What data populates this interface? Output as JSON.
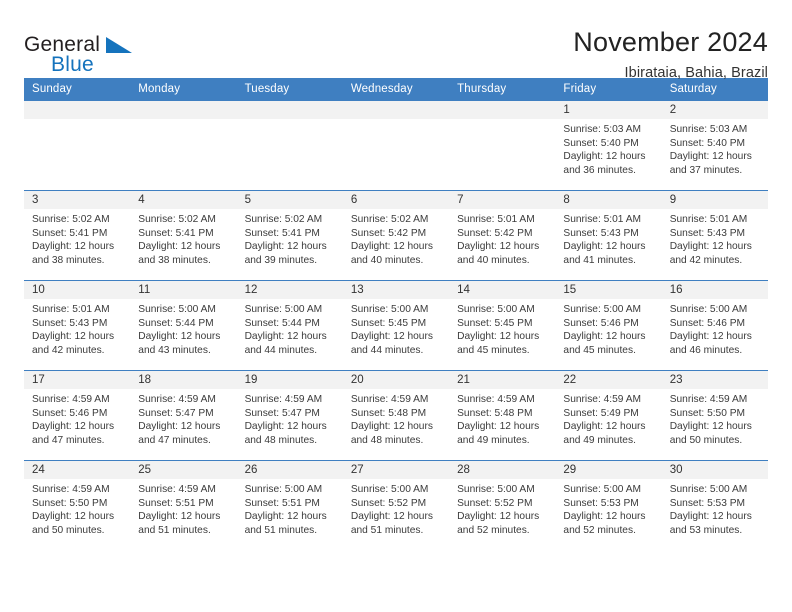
{
  "logo": {
    "word_primary": "General",
    "word_secondary": "Blue",
    "triangle_color": "#1573bd"
  },
  "header": {
    "title": "November 2024",
    "subtitle": "Ibirataia, Bahia, Brazil"
  },
  "colors": {
    "header_blue": "#3f7fc1",
    "day_band_gray": "#f2f2f2",
    "logo_blue": "#1573bd",
    "text": "#333333"
  },
  "calendar": {
    "weekdays": [
      "Sunday",
      "Monday",
      "Tuesday",
      "Wednesday",
      "Thursday",
      "Friday",
      "Saturday"
    ],
    "weeks": [
      [
        {
          "day": "",
          "sunrise": "",
          "sunset": "",
          "daylight_line1": "",
          "daylight_line2": "",
          "empty": true
        },
        {
          "day": "",
          "sunrise": "",
          "sunset": "",
          "daylight_line1": "",
          "daylight_line2": "",
          "empty": true
        },
        {
          "day": "",
          "sunrise": "",
          "sunset": "",
          "daylight_line1": "",
          "daylight_line2": "",
          "empty": true
        },
        {
          "day": "",
          "sunrise": "",
          "sunset": "",
          "daylight_line1": "",
          "daylight_line2": "",
          "empty": true
        },
        {
          "day": "",
          "sunrise": "",
          "sunset": "",
          "daylight_line1": "",
          "daylight_line2": "",
          "empty": true
        },
        {
          "day": "1",
          "sunrise": "Sunrise: 5:03 AM",
          "sunset": "Sunset: 5:40 PM",
          "daylight_line1": "Daylight: 12 hours",
          "daylight_line2": "and 36 minutes.",
          "empty": false
        },
        {
          "day": "2",
          "sunrise": "Sunrise: 5:03 AM",
          "sunset": "Sunset: 5:40 PM",
          "daylight_line1": "Daylight: 12 hours",
          "daylight_line2": "and 37 minutes.",
          "empty": false
        }
      ],
      [
        {
          "day": "3",
          "sunrise": "Sunrise: 5:02 AM",
          "sunset": "Sunset: 5:41 PM",
          "daylight_line1": "Daylight: 12 hours",
          "daylight_line2": "and 38 minutes.",
          "empty": false
        },
        {
          "day": "4",
          "sunrise": "Sunrise: 5:02 AM",
          "sunset": "Sunset: 5:41 PM",
          "daylight_line1": "Daylight: 12 hours",
          "daylight_line2": "and 38 minutes.",
          "empty": false
        },
        {
          "day": "5",
          "sunrise": "Sunrise: 5:02 AM",
          "sunset": "Sunset: 5:41 PM",
          "daylight_line1": "Daylight: 12 hours",
          "daylight_line2": "and 39 minutes.",
          "empty": false
        },
        {
          "day": "6",
          "sunrise": "Sunrise: 5:02 AM",
          "sunset": "Sunset: 5:42 PM",
          "daylight_line1": "Daylight: 12 hours",
          "daylight_line2": "and 40 minutes.",
          "empty": false
        },
        {
          "day": "7",
          "sunrise": "Sunrise: 5:01 AM",
          "sunset": "Sunset: 5:42 PM",
          "daylight_line1": "Daylight: 12 hours",
          "daylight_line2": "and 40 minutes.",
          "empty": false
        },
        {
          "day": "8",
          "sunrise": "Sunrise: 5:01 AM",
          "sunset": "Sunset: 5:43 PM",
          "daylight_line1": "Daylight: 12 hours",
          "daylight_line2": "and 41 minutes.",
          "empty": false
        },
        {
          "day": "9",
          "sunrise": "Sunrise: 5:01 AM",
          "sunset": "Sunset: 5:43 PM",
          "daylight_line1": "Daylight: 12 hours",
          "daylight_line2": "and 42 minutes.",
          "empty": false
        }
      ],
      [
        {
          "day": "10",
          "sunrise": "Sunrise: 5:01 AM",
          "sunset": "Sunset: 5:43 PM",
          "daylight_line1": "Daylight: 12 hours",
          "daylight_line2": "and 42 minutes.",
          "empty": false
        },
        {
          "day": "11",
          "sunrise": "Sunrise: 5:00 AM",
          "sunset": "Sunset: 5:44 PM",
          "daylight_line1": "Daylight: 12 hours",
          "daylight_line2": "and 43 minutes.",
          "empty": false
        },
        {
          "day": "12",
          "sunrise": "Sunrise: 5:00 AM",
          "sunset": "Sunset: 5:44 PM",
          "daylight_line1": "Daylight: 12 hours",
          "daylight_line2": "and 44 minutes.",
          "empty": false
        },
        {
          "day": "13",
          "sunrise": "Sunrise: 5:00 AM",
          "sunset": "Sunset: 5:45 PM",
          "daylight_line1": "Daylight: 12 hours",
          "daylight_line2": "and 44 minutes.",
          "empty": false
        },
        {
          "day": "14",
          "sunrise": "Sunrise: 5:00 AM",
          "sunset": "Sunset: 5:45 PM",
          "daylight_line1": "Daylight: 12 hours",
          "daylight_line2": "and 45 minutes.",
          "empty": false
        },
        {
          "day": "15",
          "sunrise": "Sunrise: 5:00 AM",
          "sunset": "Sunset: 5:46 PM",
          "daylight_line1": "Daylight: 12 hours",
          "daylight_line2": "and 45 minutes.",
          "empty": false
        },
        {
          "day": "16",
          "sunrise": "Sunrise: 5:00 AM",
          "sunset": "Sunset: 5:46 PM",
          "daylight_line1": "Daylight: 12 hours",
          "daylight_line2": "and 46 minutes.",
          "empty": false
        }
      ],
      [
        {
          "day": "17",
          "sunrise": "Sunrise: 4:59 AM",
          "sunset": "Sunset: 5:46 PM",
          "daylight_line1": "Daylight: 12 hours",
          "daylight_line2": "and 47 minutes.",
          "empty": false
        },
        {
          "day": "18",
          "sunrise": "Sunrise: 4:59 AM",
          "sunset": "Sunset: 5:47 PM",
          "daylight_line1": "Daylight: 12 hours",
          "daylight_line2": "and 47 minutes.",
          "empty": false
        },
        {
          "day": "19",
          "sunrise": "Sunrise: 4:59 AM",
          "sunset": "Sunset: 5:47 PM",
          "daylight_line1": "Daylight: 12 hours",
          "daylight_line2": "and 48 minutes.",
          "empty": false
        },
        {
          "day": "20",
          "sunrise": "Sunrise: 4:59 AM",
          "sunset": "Sunset: 5:48 PM",
          "daylight_line1": "Daylight: 12 hours",
          "daylight_line2": "and 48 minutes.",
          "empty": false
        },
        {
          "day": "21",
          "sunrise": "Sunrise: 4:59 AM",
          "sunset": "Sunset: 5:48 PM",
          "daylight_line1": "Daylight: 12 hours",
          "daylight_line2": "and 49 minutes.",
          "empty": false
        },
        {
          "day": "22",
          "sunrise": "Sunrise: 4:59 AM",
          "sunset": "Sunset: 5:49 PM",
          "daylight_line1": "Daylight: 12 hours",
          "daylight_line2": "and 49 minutes.",
          "empty": false
        },
        {
          "day": "23",
          "sunrise": "Sunrise: 4:59 AM",
          "sunset": "Sunset: 5:50 PM",
          "daylight_line1": "Daylight: 12 hours",
          "daylight_line2": "and 50 minutes.",
          "empty": false
        }
      ],
      [
        {
          "day": "24",
          "sunrise": "Sunrise: 4:59 AM",
          "sunset": "Sunset: 5:50 PM",
          "daylight_line1": "Daylight: 12 hours",
          "daylight_line2": "and 50 minutes.",
          "empty": false
        },
        {
          "day": "25",
          "sunrise": "Sunrise: 4:59 AM",
          "sunset": "Sunset: 5:51 PM",
          "daylight_line1": "Daylight: 12 hours",
          "daylight_line2": "and 51 minutes.",
          "empty": false
        },
        {
          "day": "26",
          "sunrise": "Sunrise: 5:00 AM",
          "sunset": "Sunset: 5:51 PM",
          "daylight_line1": "Daylight: 12 hours",
          "daylight_line2": "and 51 minutes.",
          "empty": false
        },
        {
          "day": "27",
          "sunrise": "Sunrise: 5:00 AM",
          "sunset": "Sunset: 5:52 PM",
          "daylight_line1": "Daylight: 12 hours",
          "daylight_line2": "and 51 minutes.",
          "empty": false
        },
        {
          "day": "28",
          "sunrise": "Sunrise: 5:00 AM",
          "sunset": "Sunset: 5:52 PM",
          "daylight_line1": "Daylight: 12 hours",
          "daylight_line2": "and 52 minutes.",
          "empty": false
        },
        {
          "day": "29",
          "sunrise": "Sunrise: 5:00 AM",
          "sunset": "Sunset: 5:53 PM",
          "daylight_line1": "Daylight: 12 hours",
          "daylight_line2": "and 52 minutes.",
          "empty": false
        },
        {
          "day": "30",
          "sunrise": "Sunrise: 5:00 AM",
          "sunset": "Sunset: 5:53 PM",
          "daylight_line1": "Daylight: 12 hours",
          "daylight_line2": "and 53 minutes.",
          "empty": false
        }
      ]
    ]
  }
}
